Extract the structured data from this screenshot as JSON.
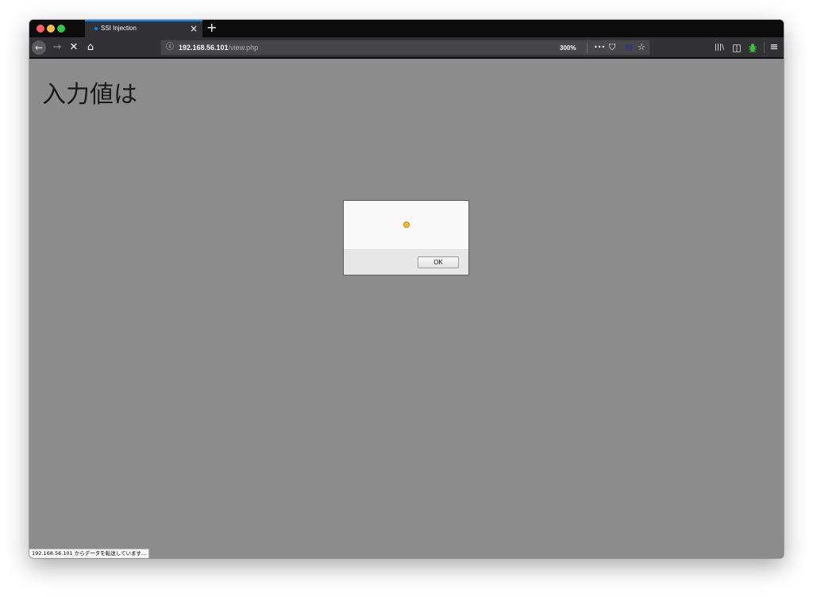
{
  "tab": {
    "title": "SSI Injection",
    "close": "×"
  },
  "newtab_label": "+",
  "toolbar": {
    "back": "←",
    "forward": "→",
    "stop": "✕",
    "home": "⌂",
    "url_host": "192.168.56.101",
    "url_path": "/view.php",
    "zoom": "300%",
    "more": "•••",
    "pocket": "⛉",
    "star": "☆",
    "library": "|||\\",
    "sidebar": "◫",
    "menu": "≡"
  },
  "content": {
    "heading": "入力値は"
  },
  "dialog": {
    "ok_label": "OK"
  },
  "status_text": "192.168.56.101 からデータを転送しています..."
}
